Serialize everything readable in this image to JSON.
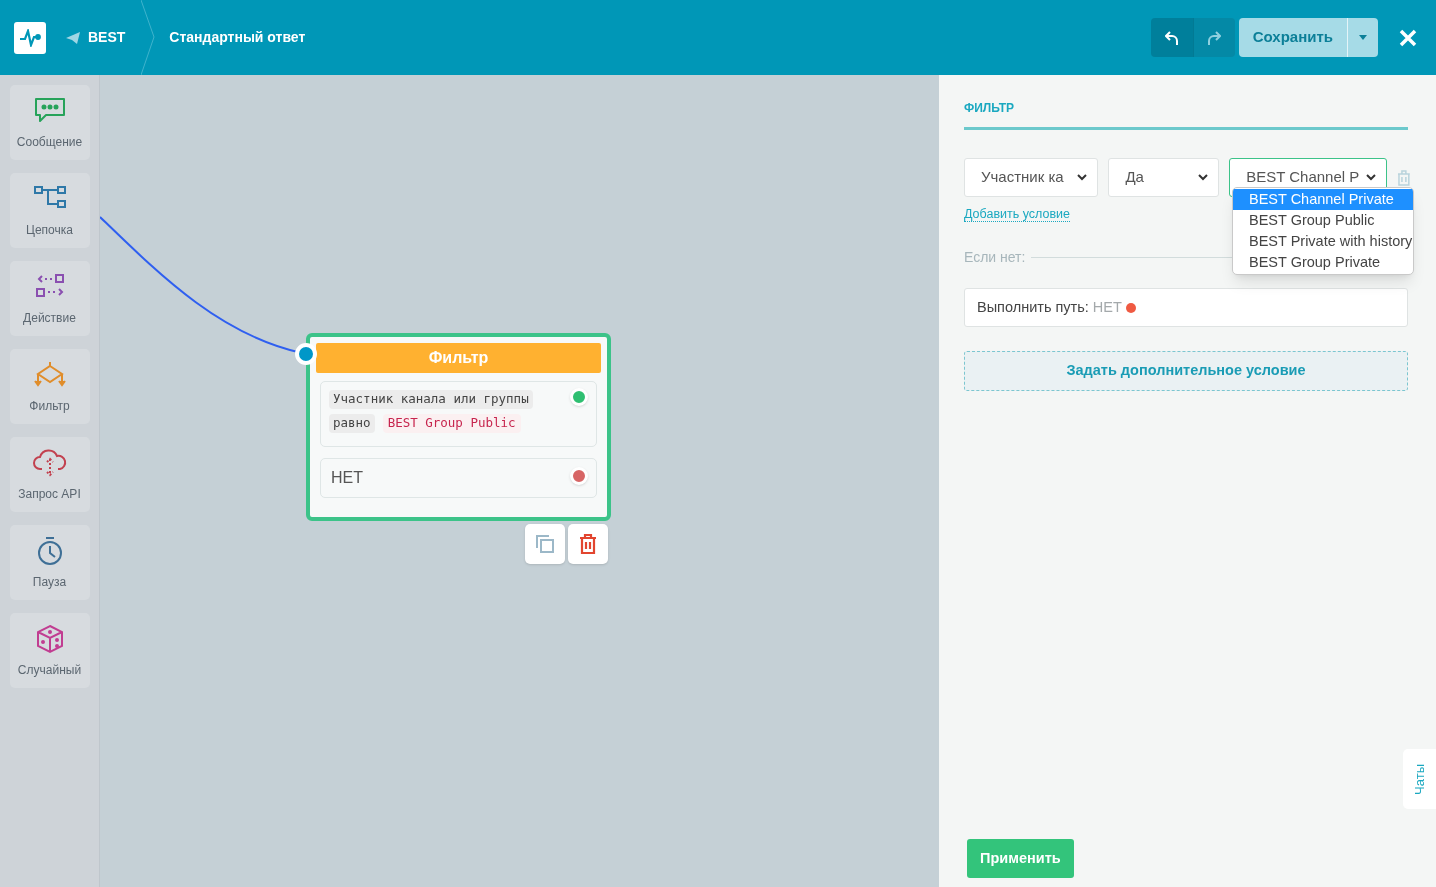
{
  "header": {
    "channel": "BEST",
    "title": "Стандартный ответ",
    "save": "Сохранить"
  },
  "palette": [
    {
      "kind": "message",
      "label": "Сообщение"
    },
    {
      "kind": "chain",
      "label": "Цепочка"
    },
    {
      "kind": "action",
      "label": "Действие"
    },
    {
      "kind": "filter",
      "label": "Фильтр"
    },
    {
      "kind": "api",
      "label": "Запрос API"
    },
    {
      "kind": "pause",
      "label": "Пауза"
    },
    {
      "kind": "random",
      "label": "Случайный"
    }
  ],
  "node": {
    "title": "Фильтр",
    "condition": {
      "field": "Участник канала или группы",
      "operator": "равно",
      "value": "BEST Group Public"
    },
    "no_branch": "НЕТ"
  },
  "panel": {
    "title": "ФИЛЬТР",
    "selects": [
      {
        "value": "Участник ка",
        "focused": false
      },
      {
        "value": "Да",
        "focused": false
      },
      {
        "value": "BEST Channel P",
        "focused": true
      }
    ],
    "options": [
      {
        "label": "BEST Channel Private",
        "selected": true
      },
      {
        "label": "BEST Group Public",
        "selected": false
      },
      {
        "label": "BEST Private with history",
        "selected": false
      },
      {
        "label": "BEST Group Private",
        "selected": false
      }
    ],
    "add_condition": "Добавить условие",
    "else_label": "Если нет:",
    "execute_label": "Выполнить путь:",
    "execute_value": "НЕТ",
    "extra_button": "Задать дополнительное условие",
    "apply": "Применить",
    "chats": "Чаты"
  }
}
